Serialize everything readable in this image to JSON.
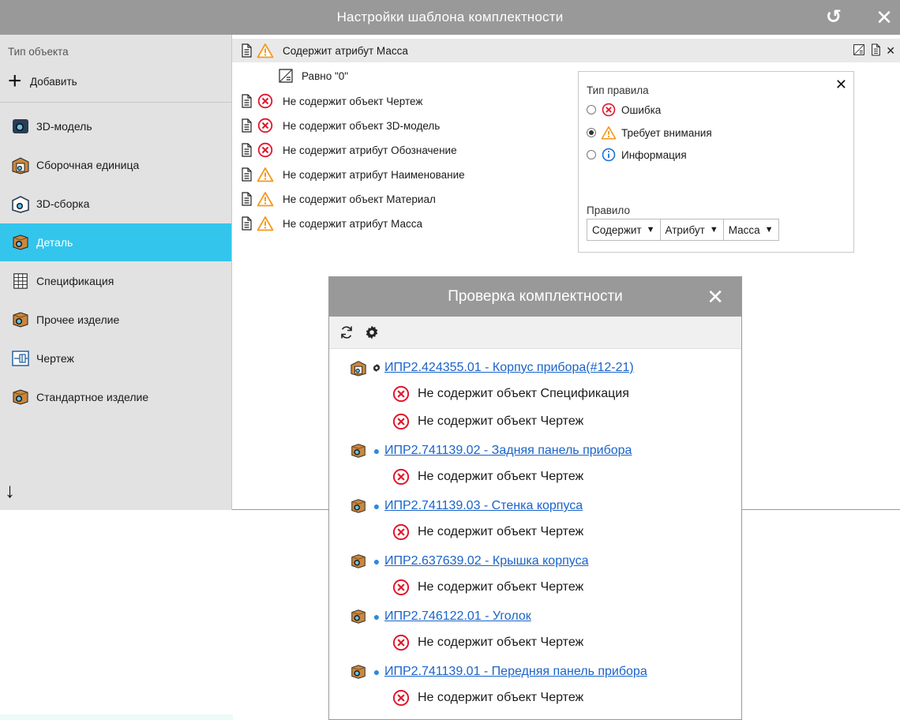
{
  "window": {
    "title": "Настройки шаблона комплектности"
  },
  "sidebar": {
    "header": "Тип объекта",
    "add_label": "Добавить",
    "items": [
      {
        "label": "3D-модель",
        "icon": "model-3d-icon"
      },
      {
        "label": "Сборочная единица",
        "icon": "assembly-unit-icon"
      },
      {
        "label": "3D-сборка",
        "icon": "assembly-3d-icon"
      },
      {
        "label": "Деталь",
        "icon": "part-icon",
        "active": true
      },
      {
        "label": "Спецификация",
        "icon": "specification-icon"
      },
      {
        "label": "Прочее изделие",
        "icon": "other-product-icon"
      },
      {
        "label": "Чертеж",
        "icon": "drawing-icon"
      },
      {
        "label": "Стандартное изделие",
        "icon": "standard-product-icon"
      }
    ]
  },
  "rules": {
    "items": [
      {
        "text": "Содержит атрибут Масса",
        "severity": "warning",
        "sub": "Равно \"0\""
      },
      {
        "text": "Не содержит объект Чертеж",
        "severity": "error"
      },
      {
        "text": "Не содержит объект 3D-модель",
        "severity": "error"
      },
      {
        "text": "Не содержит атрибут Обозначение",
        "severity": "error"
      },
      {
        "text": "Не содержит атрибут Наименование",
        "severity": "warning"
      },
      {
        "text": "Не содержит объект Материал",
        "severity": "warning"
      },
      {
        "text": "Не содержит атрибут Масса",
        "severity": "warning"
      }
    ]
  },
  "rule_panel": {
    "type_label": "Тип правила",
    "options": [
      "Ошибка",
      "Требует внимания",
      "Информация"
    ],
    "selected_option": "Требует внимания",
    "rule_label": "Правило",
    "selects": [
      "Содержит",
      "Атрибут",
      "Масса"
    ]
  },
  "check_dialog": {
    "title": "Проверка комплектности",
    "items": [
      {
        "link": "ИПР2.424355.01 - Корпус прибора(#12-21)",
        "errors": [
          "Не содержит объект Спецификация",
          "Не содержит объект Чертеж"
        ]
      },
      {
        "link": "ИПР2.741139.02 - Задняя панель прибора",
        "errors": [
          "Не содержит объект Чертеж"
        ]
      },
      {
        "link": "ИПР2.741139.03 - Стенка корпуса",
        "errors": [
          "Не содержит объект Чертеж"
        ]
      },
      {
        "link": "ИПР2.637639.02 - Крышка корпуса",
        "errors": [
          "Не содержит объект Чертеж"
        ]
      },
      {
        "link": "ИПР2.746122.01 - Уголок",
        "errors": [
          "Не содержит объект Чертеж"
        ]
      },
      {
        "link": "ИПР2.741139.01 - Передняя панель прибора",
        "errors": [
          "Не содержит объект Чертеж"
        ]
      }
    ]
  },
  "colors": {
    "titlebar": "#999999",
    "active": "#33c5ec",
    "link": "#1a63c9",
    "error": "#e0162b",
    "warning": "#f39a1e",
    "info": "#1a73d9"
  }
}
